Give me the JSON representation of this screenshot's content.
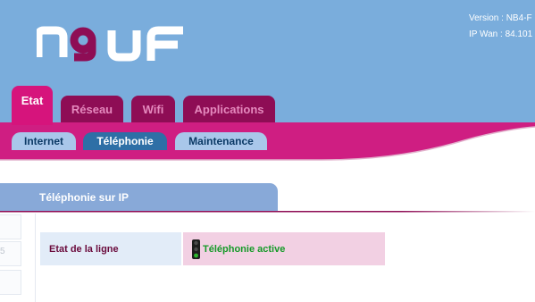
{
  "header": {
    "logo_text": "N9UF",
    "version": "Version : NB4-F",
    "ip_wan": "IP Wan : 84.101"
  },
  "main_tabs": [
    {
      "label": "Etat",
      "active": true
    },
    {
      "label": "Réseau",
      "active": false
    },
    {
      "label": "Wifi",
      "active": false
    },
    {
      "label": "Applications",
      "active": false
    }
  ],
  "sub_tabs": [
    {
      "label": "Internet",
      "active": false
    },
    {
      "label": "Téléphonie",
      "active": true
    },
    {
      "label": "Maintenance",
      "active": false
    }
  ],
  "section": {
    "title": "Téléphonie sur IP",
    "left_rail_value": "5"
  },
  "status_row": {
    "label": "Etat de la ligne",
    "value": "Téléphonie active",
    "indicator_icon": "traffic-light-green-icon",
    "indicator_color": "#2db52d"
  },
  "colors": {
    "header_blue": "#7aaddc",
    "brand_magenta": "#d6147c",
    "tab_inactive": "#8e0d55",
    "subtab_active": "#2e6fa6",
    "subtab_inactive": "#a9c7ea",
    "section_head": "#88a9d8",
    "status_green": "#159a28"
  }
}
